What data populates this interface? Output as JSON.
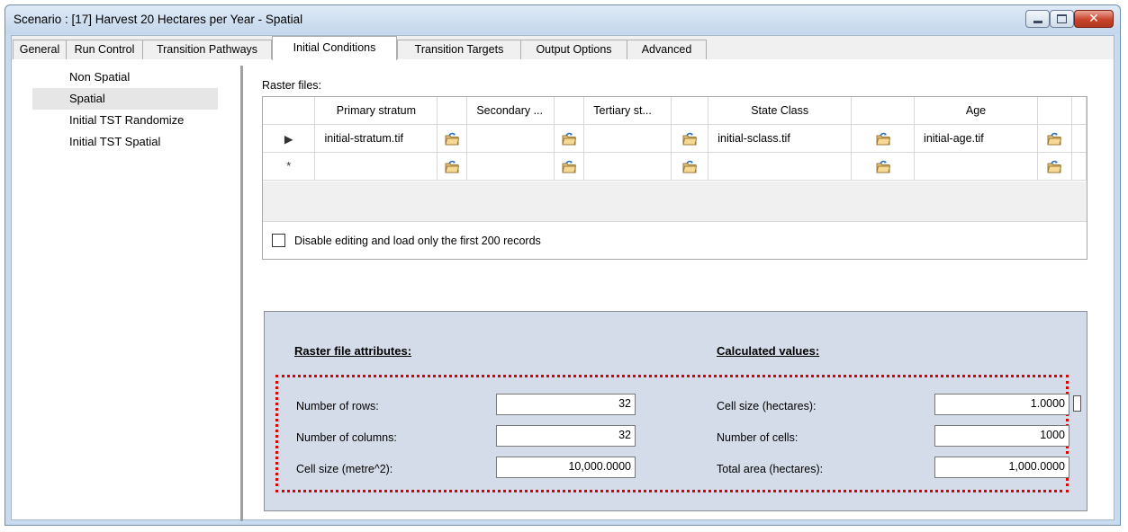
{
  "window": {
    "title": "Scenario : [17] Harvest 20 Hectares per Year - Spatial"
  },
  "tabs": [
    {
      "label": "General"
    },
    {
      "label": "Run Control"
    },
    {
      "label": "Transition Pathways"
    },
    {
      "label": "Initial Conditions"
    },
    {
      "label": "Transition Targets"
    },
    {
      "label": "Output Options"
    },
    {
      "label": "Advanced"
    }
  ],
  "active_tab": "Initial Conditions",
  "left_list": [
    {
      "label": "Non Spatial"
    },
    {
      "label": "Spatial"
    },
    {
      "label": "Initial TST Randomize"
    },
    {
      "label": "Initial TST Spatial"
    }
  ],
  "selected_left_item": "Spatial",
  "raster_label": "Raster files:",
  "grid": {
    "headers": [
      "Primary stratum",
      "Secondary ...",
      "Tertiary st...",
      "State Class",
      "Age"
    ],
    "rows": [
      {
        "marker": "▶",
        "cells": [
          "initial-stratum.tif",
          "",
          "",
          "initial-sclass.tif",
          "initial-age.tif"
        ]
      },
      {
        "marker": "*",
        "cells": [
          "",
          "",
          "",
          "",
          ""
        ]
      }
    ]
  },
  "disable_editing_label": "Disable editing and load only the first 200 records",
  "attributes": {
    "raster_heading": "Raster file attributes:",
    "calculated_heading": "Calculated values:",
    "rows_label": "Number of rows:",
    "rows_value": "32",
    "columns_label": "Number of columns:",
    "columns_value": "32",
    "cellsize_m2_label": "Cell size (metre^2):",
    "cellsize_m2_value": "10,000.0000",
    "cellsize_ha_label": "Cell size (hectares):",
    "cellsize_ha_value": "1.0000",
    "num_cells_label": "Number of cells:",
    "num_cells_value": "1000",
    "total_area_label": "Total area (hectares):",
    "total_area_value": "1,000.0000"
  },
  "colors": {
    "highlight_border": "#e00000",
    "attr_panel_bg": "#d5dce9",
    "window_frame": "#c9dbee"
  },
  "icons": [
    "minimize-icon",
    "maximize-icon",
    "close-icon",
    "row-pointer-icon",
    "new-row-icon",
    "folder-open-icon"
  ]
}
